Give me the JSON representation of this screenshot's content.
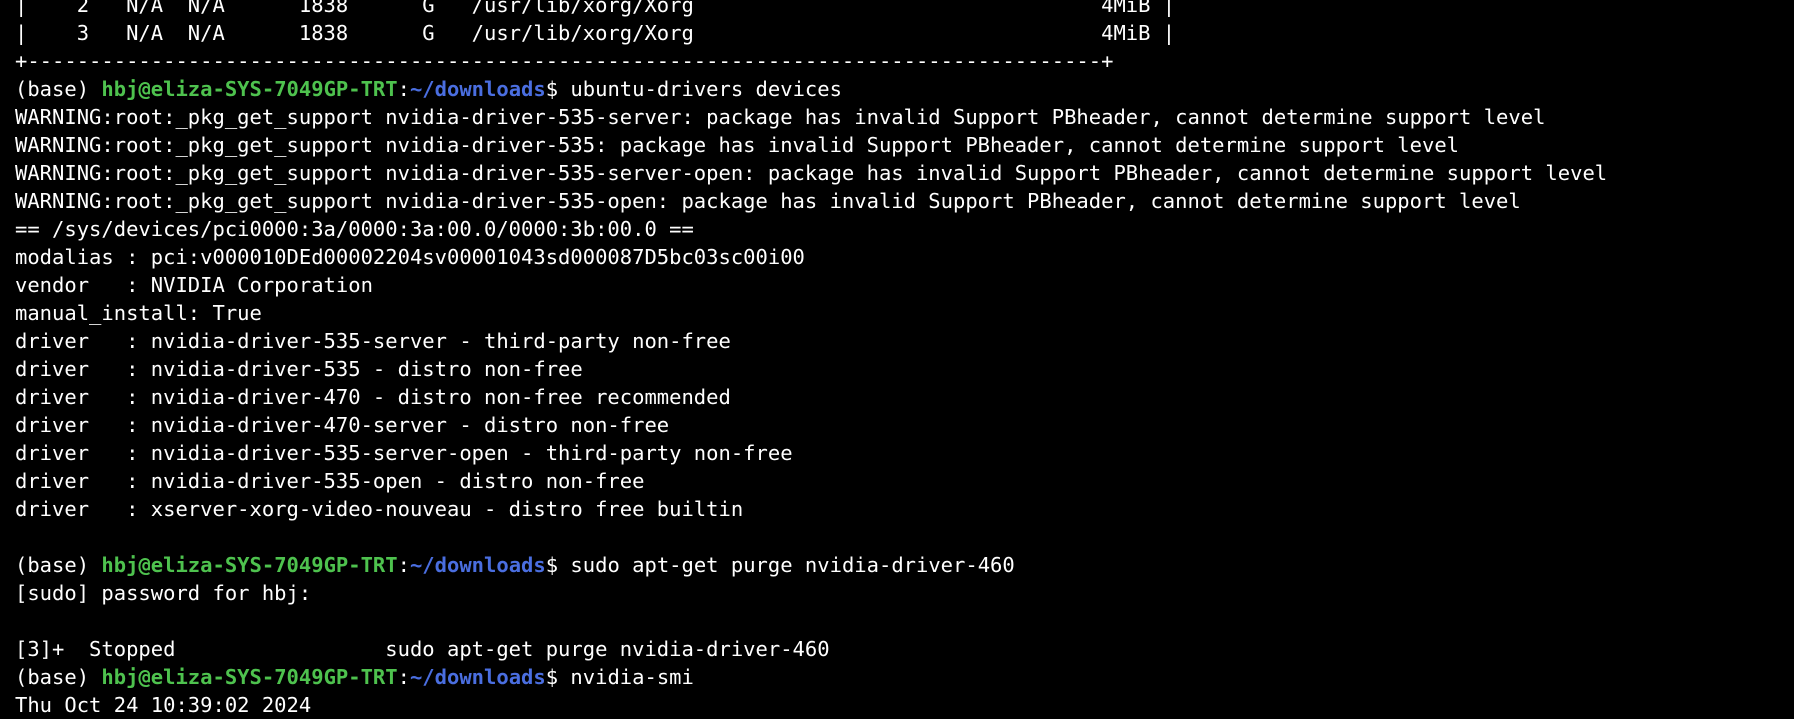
{
  "terminal": {
    "lines": [
      {
        "kind": "text",
        "text": "|    2   N/A  N/A      1838      G   /usr/lib/xorg/Xorg                                 4MiB |"
      },
      {
        "kind": "text",
        "text": "|    3   N/A  N/A      1838      G   /usr/lib/xorg/Xorg                                 4MiB |"
      },
      {
        "kind": "text",
        "text": "+---------------------------------------------------------------------------------------+"
      },
      {
        "kind": "prompt",
        "env": "(base) ",
        "user": "hbj@eliza-SYS-7049GP-TRT",
        "colon": ":",
        "path": "~/downloads",
        "dollar": "$ ",
        "cmd": "ubuntu-drivers devices"
      },
      {
        "kind": "text",
        "text": "WARNING:root:_pkg_get_support nvidia-driver-535-server: package has invalid Support PBheader, cannot determine support level"
      },
      {
        "kind": "text",
        "text": "WARNING:root:_pkg_get_support nvidia-driver-535: package has invalid Support PBheader, cannot determine support level"
      },
      {
        "kind": "text",
        "text": "WARNING:root:_pkg_get_support nvidia-driver-535-server-open: package has invalid Support PBheader, cannot determine support level"
      },
      {
        "kind": "text",
        "text": "WARNING:root:_pkg_get_support nvidia-driver-535-open: package has invalid Support PBheader, cannot determine support level"
      },
      {
        "kind": "text",
        "text": "== /sys/devices/pci0000:3a/0000:3a:00.0/0000:3b:00.0 =="
      },
      {
        "kind": "text",
        "text": "modalias : pci:v000010DEd00002204sv00001043sd000087D5bc03sc00i00"
      },
      {
        "kind": "text",
        "text": "vendor   : NVIDIA Corporation"
      },
      {
        "kind": "text",
        "text": "manual_install: True"
      },
      {
        "kind": "text",
        "text": "driver   : nvidia-driver-535-server - third-party non-free"
      },
      {
        "kind": "text",
        "text": "driver   : nvidia-driver-535 - distro non-free"
      },
      {
        "kind": "text",
        "text": "driver   : nvidia-driver-470 - distro non-free recommended"
      },
      {
        "kind": "text",
        "text": "driver   : nvidia-driver-470-server - distro non-free"
      },
      {
        "kind": "text",
        "text": "driver   : nvidia-driver-535-server-open - third-party non-free"
      },
      {
        "kind": "text",
        "text": "driver   : nvidia-driver-535-open - distro non-free"
      },
      {
        "kind": "text",
        "text": "driver   : xserver-xorg-video-nouveau - distro free builtin"
      },
      {
        "kind": "text",
        "text": ""
      },
      {
        "kind": "prompt",
        "env": "(base) ",
        "user": "hbj@eliza-SYS-7049GP-TRT",
        "colon": ":",
        "path": "~/downloads",
        "dollar": "$ ",
        "cmd": "sudo apt-get purge nvidia-driver-460"
      },
      {
        "kind": "text",
        "text": "[sudo] password for hbj:"
      },
      {
        "kind": "text",
        "text": ""
      },
      {
        "kind": "text",
        "text": "[3]+  Stopped                 sudo apt-get purge nvidia-driver-460"
      },
      {
        "kind": "prompt",
        "env": "(base) ",
        "user": "hbj@eliza-SYS-7049GP-TRT",
        "colon": ":",
        "path": "~/downloads",
        "dollar": "$ ",
        "cmd": "nvidia-smi"
      },
      {
        "kind": "text",
        "text": "Thu Oct 24 10:39:02 2024"
      }
    ]
  },
  "colors": {
    "background": "#000000",
    "text": "#ffffff",
    "user": "#4ec24e",
    "path": "#4a6ee0"
  }
}
